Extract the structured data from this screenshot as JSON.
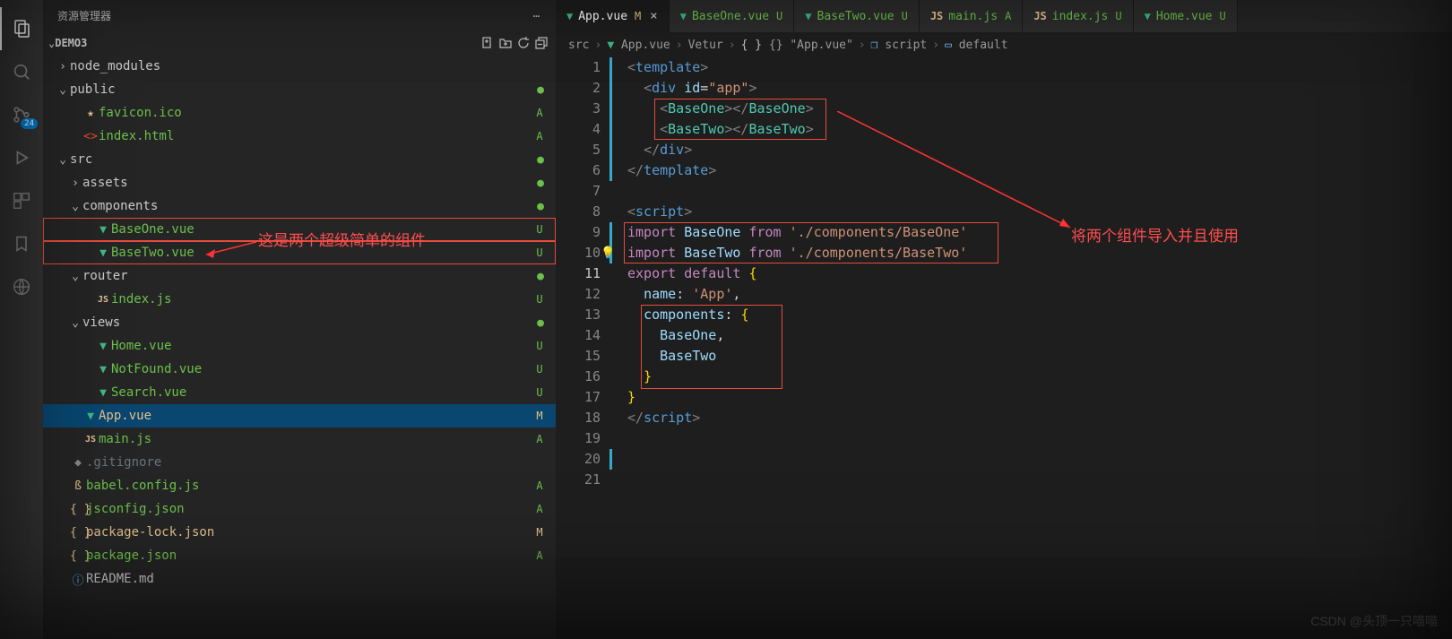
{
  "sidebar": {
    "title": "资源管理器",
    "section": "DEMO3",
    "actions": [
      "new-file",
      "new-folder",
      "refresh",
      "collapse"
    ],
    "badge": "24",
    "tree": [
      {
        "depth": 0,
        "kind": "folder",
        "open": false,
        "name": "node_modules",
        "dim": true
      },
      {
        "depth": 0,
        "kind": "folder",
        "open": true,
        "name": "public",
        "dot": "grn"
      },
      {
        "depth": 1,
        "kind": "file",
        "icon": "star",
        "name": "favicon.ico",
        "status": "A"
      },
      {
        "depth": 1,
        "kind": "file",
        "icon": "html",
        "name": "index.html",
        "status": "A"
      },
      {
        "depth": 0,
        "kind": "folder",
        "open": true,
        "name": "src",
        "dot": "grn"
      },
      {
        "depth": 1,
        "kind": "folder",
        "open": false,
        "name": "assets",
        "dot": "grn"
      },
      {
        "depth": 1,
        "kind": "folder",
        "open": true,
        "name": "components",
        "dot": "grn"
      },
      {
        "depth": 2,
        "kind": "file",
        "icon": "vue",
        "name": "BaseOne.vue",
        "status": "U",
        "box": true
      },
      {
        "depth": 2,
        "kind": "file",
        "icon": "vue",
        "name": "BaseTwo.vue",
        "status": "U",
        "box": true
      },
      {
        "depth": 1,
        "kind": "folder",
        "open": true,
        "name": "router",
        "dot": "grn"
      },
      {
        "depth": 2,
        "kind": "file",
        "icon": "js",
        "name": "index.js",
        "status": "U"
      },
      {
        "depth": 1,
        "kind": "folder",
        "open": true,
        "name": "views",
        "dot": "grn"
      },
      {
        "depth": 2,
        "kind": "file",
        "icon": "vue",
        "name": "Home.vue",
        "status": "U"
      },
      {
        "depth": 2,
        "kind": "file",
        "icon": "vue",
        "name": "NotFound.vue",
        "status": "U"
      },
      {
        "depth": 2,
        "kind": "file",
        "icon": "vue",
        "name": "Search.vue",
        "status": "U"
      },
      {
        "depth": 1,
        "kind": "file",
        "icon": "vue",
        "name": "App.vue",
        "status": "M",
        "selected": true
      },
      {
        "depth": 1,
        "kind": "file",
        "icon": "js",
        "name": "main.js",
        "status": "A"
      },
      {
        "depth": 0,
        "kind": "file",
        "icon": "git",
        "name": ".gitignore",
        "dim": true
      },
      {
        "depth": 0,
        "kind": "file",
        "icon": "babel",
        "name": "babel.config.js",
        "status": "A"
      },
      {
        "depth": 0,
        "kind": "file",
        "icon": "json",
        "name": "jsconfig.json",
        "status": "A"
      },
      {
        "depth": 0,
        "kind": "file",
        "icon": "json",
        "name": "package-lock.json",
        "status": "M"
      },
      {
        "depth": 0,
        "kind": "file",
        "icon": "json",
        "name": "package.json",
        "status": "A"
      },
      {
        "depth": 0,
        "kind": "file",
        "icon": "readme",
        "name": "README.md"
      }
    ]
  },
  "tabs": [
    {
      "icon": "vue",
      "name": "App.vue",
      "status": "M",
      "active": true,
      "close": true
    },
    {
      "icon": "vue",
      "name": "BaseOne.vue",
      "status": "U"
    },
    {
      "icon": "vue",
      "name": "BaseTwo.vue",
      "status": "U"
    },
    {
      "icon": "js",
      "name": "main.js",
      "status": "A"
    },
    {
      "icon": "js",
      "name": "index.js",
      "status": "U"
    },
    {
      "icon": "vue",
      "name": "Home.vue",
      "status": "U"
    }
  ],
  "breadcrumbs": [
    "src",
    "App.vue",
    "Vetur",
    "{} \"App.vue\"",
    "script",
    "default"
  ],
  "bcicons": [
    "",
    "vue",
    "",
    "json",
    "cube",
    "var"
  ],
  "code": {
    "totalLines": 21,
    "currentLine": 11,
    "mods": [
      1,
      1,
      1,
      1,
      1,
      1,
      0,
      0,
      1,
      1,
      0,
      0,
      0,
      0,
      0,
      0,
      0,
      0,
      0,
      1,
      0
    ]
  },
  "annotations": {
    "left": "这是两个超级简单的组件",
    "right": "将两个组件导入并且使用"
  },
  "watermark": "CSDN @头顶一只喵喵"
}
